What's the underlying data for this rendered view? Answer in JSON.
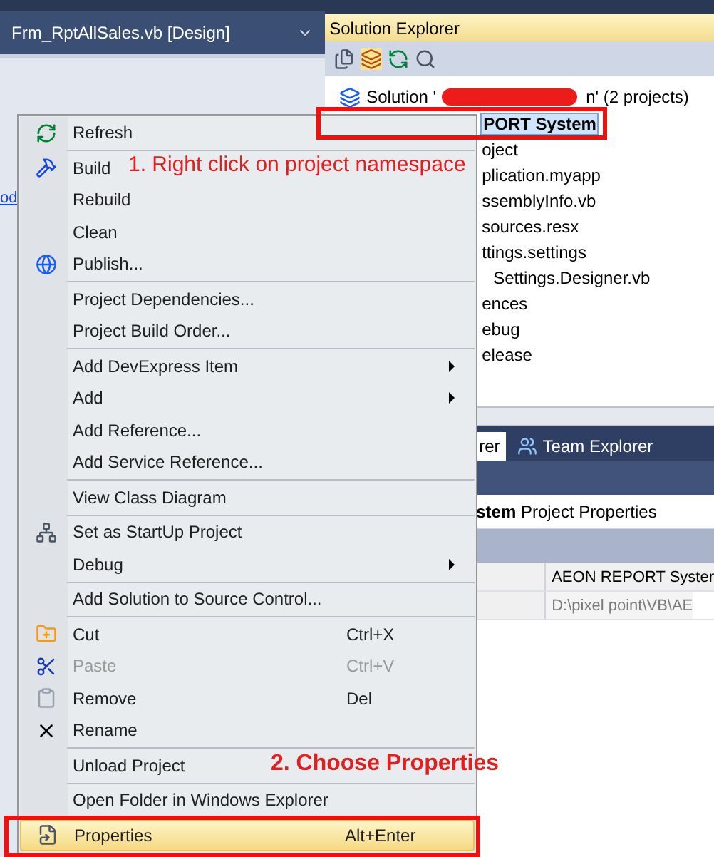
{
  "editor_tab": {
    "title": "Frm_RptAllSales.vb [Design]"
  },
  "editor": {
    "link_fragment": "od"
  },
  "solution_explorer": {
    "title": "Solution Explorer",
    "solution_prefix": "Solution '",
    "solution_suffix": "n' (2 projects)",
    "items": [
      {
        "label": "PORT System",
        "selected": true
      },
      {
        "label": "oject",
        "selected": false
      },
      {
        "label": "plication.myapp",
        "selected": false
      },
      {
        "label": "ssemblyInfo.vb",
        "selected": false
      },
      {
        "label": "sources.resx",
        "selected": false
      },
      {
        "label": "ttings.settings",
        "selected": false
      },
      {
        "label": "Settings.Designer.vb",
        "selected": false
      },
      {
        "label": "ences",
        "selected": false
      },
      {
        "label": "ebug",
        "selected": false
      },
      {
        "label": "elease",
        "selected": false
      }
    ]
  },
  "bottom_tabs": [
    {
      "label": "rer",
      "selected": true
    },
    {
      "label": "Team Explorer",
      "selected": false
    }
  ],
  "properties": {
    "title_bold": "stem",
    "title": "Project Properties",
    "rows": [
      {
        "value": "AEON REPORT Syster",
        "disabled": false
      },
      {
        "value": "D:\\pixel point\\VB\\AE",
        "disabled": true
      }
    ]
  },
  "context_menu": {
    "groups": [
      [
        {
          "kind": "command",
          "label": "Refresh",
          "disabled": false,
          "selected": false
        }
      ],
      [
        {
          "kind": "command",
          "label": "Build",
          "disabled": false,
          "selected": false
        },
        {
          "kind": "command",
          "label": "Rebuild",
          "disabled": false,
          "selected": false
        },
        {
          "kind": "command",
          "label": "Clean",
          "disabled": false,
          "selected": false
        },
        {
          "kind": "command",
          "label": "Publish...",
          "disabled": false,
          "selected": false
        }
      ],
      [
        {
          "kind": "command",
          "label": "Project Dependencies...",
          "disabled": false,
          "selected": false
        },
        {
          "kind": "command",
          "label": "Project Build Order...",
          "disabled": false,
          "selected": false
        }
      ],
      [
        {
          "kind": "submenu",
          "label": "Add DevExpress Item",
          "disabled": false,
          "selected": false
        },
        {
          "kind": "submenu",
          "label": "Add",
          "disabled": false,
          "selected": false
        },
        {
          "kind": "command",
          "label": "Add Reference...",
          "disabled": false,
          "selected": false
        },
        {
          "kind": "command",
          "label": "Add Service Reference...",
          "disabled": false,
          "selected": false
        }
      ],
      [
        {
          "kind": "command",
          "label": "View Class Diagram",
          "disabled": false,
          "selected": false
        }
      ],
      [
        {
          "kind": "command",
          "label": "Set as StartUp Project",
          "disabled": false,
          "selected": false
        },
        {
          "kind": "submenu",
          "label": "Debug",
          "disabled": false,
          "selected": false
        }
      ],
      [
        {
          "kind": "command",
          "label": "Add Solution to Source Control...",
          "disabled": false,
          "selected": false
        }
      ],
      [
        {
          "kind": "command",
          "label": "Cut",
          "shortcut": "Ctrl+X",
          "disabled": false,
          "selected": false
        },
        {
          "kind": "command",
          "label": "Paste",
          "shortcut": "Ctrl+V",
          "disabled": true,
          "selected": false
        },
        {
          "kind": "command",
          "label": "Remove",
          "shortcut": "Del",
          "disabled": false,
          "selected": false
        },
        {
          "kind": "command",
          "label": "Rename",
          "disabled": false,
          "selected": false
        }
      ],
      [
        {
          "kind": "command",
          "label": "Unload Project",
          "disabled": false,
          "selected": false
        }
      ],
      [
        {
          "kind": "command",
          "label": "Open Folder in Windows Explorer",
          "disabled": false,
          "selected": false
        }
      ],
      [
        {
          "kind": "command",
          "label": "Properties",
          "shortcut": "Alt+Enter",
          "disabled": false,
          "selected": true
        }
      ]
    ]
  },
  "annotations": [
    {
      "text": "1. Right click on project namespace"
    },
    {
      "text": "2. Choose Properties"
    }
  ]
}
